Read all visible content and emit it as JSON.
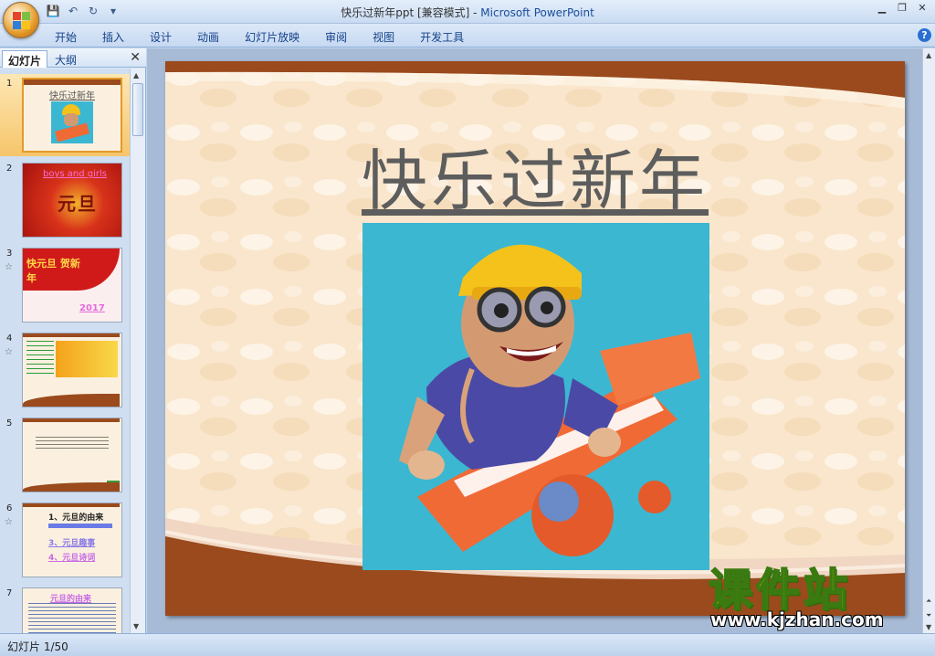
{
  "window": {
    "title": "快乐过新年ppt [兼容模式] - ",
    "app_name": "Microsoft PowerPoint"
  },
  "ribbon": {
    "tabs": [
      "开始",
      "插入",
      "设计",
      "动画",
      "幻灯片放映",
      "审阅",
      "视图",
      "开发工具"
    ]
  },
  "left_panel": {
    "tabs": [
      "幻灯片",
      "大纲"
    ],
    "slides": [
      {
        "number": "1",
        "title": "快乐过新年",
        "has_anim": false,
        "selected": true
      },
      {
        "number": "2",
        "title": "boys and girls",
        "caption": "元旦",
        "has_anim": false
      },
      {
        "number": "3",
        "title": "快元旦 贺新年",
        "caption": "2017",
        "has_anim": true
      },
      {
        "number": "4",
        "title": "",
        "has_anim": true
      },
      {
        "number": "5",
        "title": "",
        "has_anim": false
      },
      {
        "number": "6",
        "title": "1、元旦的由来",
        "lines": [
          "3、元旦趣事",
          "4、元旦诗词"
        ],
        "has_anim": true
      },
      {
        "number": "7",
        "title": "元旦的由来",
        "has_anim": false
      }
    ]
  },
  "slide": {
    "title": "快乐过新年"
  },
  "watermark": {
    "text": "课件站",
    "url": "www.kjzhan.com"
  },
  "status": {
    "slide_counter": "幻灯片 1/50"
  },
  "colors": {
    "slide_bg": "#fcefd9",
    "slide_border_brown": "#9a4a1c",
    "title_gray": "#5d5d5d",
    "pic_bg": "#3bb7d2"
  }
}
